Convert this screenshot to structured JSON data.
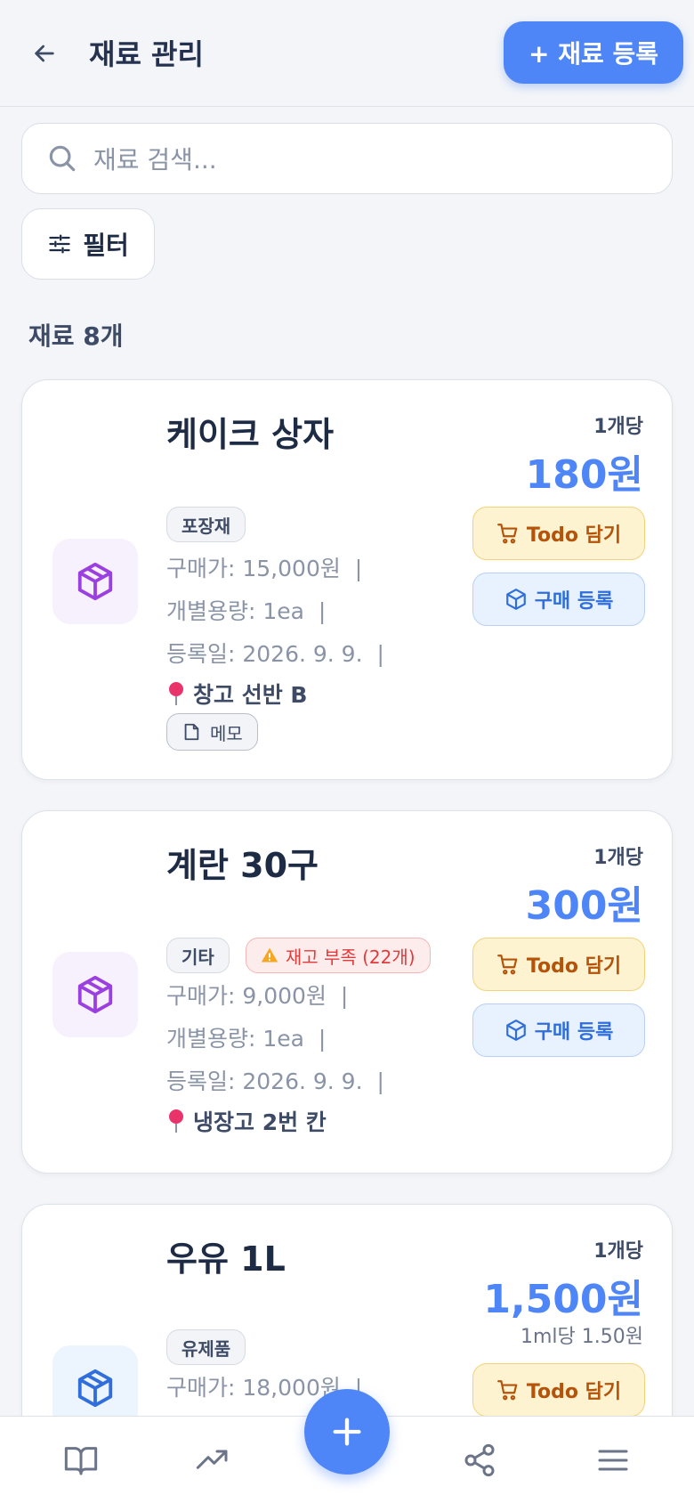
{
  "header": {
    "title": "재료 관리",
    "add_button": "+ 재료 등록"
  },
  "search": {
    "placeholder": "재료 검색..."
  },
  "filter": {
    "label": "필터"
  },
  "list": {
    "count_label": "재료 8개"
  },
  "cards": [
    {
      "name": "케이크 상자",
      "unit_label": "1개당",
      "price": "180원",
      "tags": [
        "포장재"
      ],
      "purchase_price": "구매가: 15,000원",
      "unit_volume": "개별용량: 1ea",
      "registered": "등록일: 2026. 9. 9.",
      "location": "창고 선반 B",
      "memo": "메모",
      "todo_button": "Todo 담기",
      "buy_button": "구매 등록"
    },
    {
      "name": "계란 30구",
      "unit_label": "1개당",
      "price": "300원",
      "tags": [
        "기타"
      ],
      "warning": "재고 부족 (22개)",
      "purchase_price": "구매가: 9,000원",
      "unit_volume": "개별용량: 1ea",
      "registered": "등록일: 2026. 9. 9.",
      "location": "냉장고 2번 칸",
      "todo_button": "Todo 담기",
      "buy_button": "구매 등록"
    },
    {
      "name": "우유 1L",
      "unit_label": "1개당",
      "price": "1,500원",
      "sub_price": "1ml당 1.50원",
      "tags": [
        "유제품"
      ],
      "purchase_price": "구매가: 18,000원",
      "todo_button": "Todo 담기"
    }
  ],
  "colors": {
    "accent": "#4f86f7",
    "warning": "#e13b3b",
    "todo": "#b45309"
  }
}
